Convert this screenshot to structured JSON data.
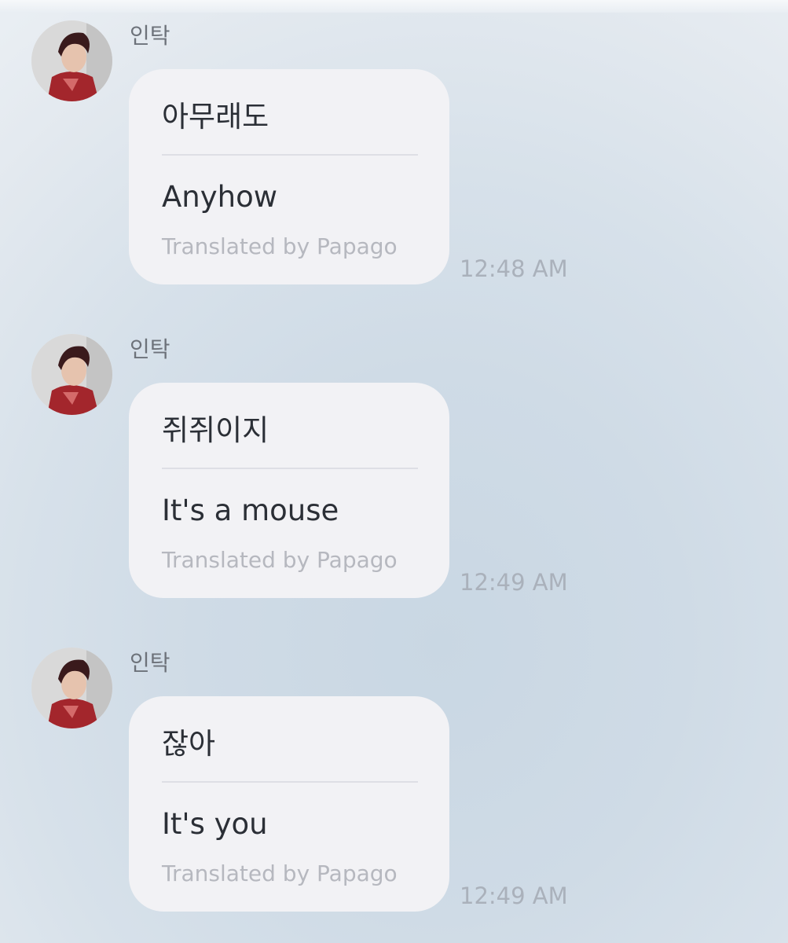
{
  "chat": {
    "messages": [
      {
        "sender": "인탁",
        "avatar": "profile-photo",
        "original": "아무래도",
        "translation": "Anyhow",
        "translator_note": "Translated by Papago",
        "time": "12:48 AM"
      },
      {
        "sender": "인탁",
        "avatar": "profile-photo",
        "original": "쥐쥐이지",
        "translation": "It's a mouse",
        "translator_note": "Translated by Papago",
        "time": "12:49 AM"
      },
      {
        "sender": "인탁",
        "avatar": "profile-photo",
        "original": "잖아",
        "translation": "It's you",
        "translator_note": "Translated by Papago",
        "time": "12:49 AM"
      }
    ]
  }
}
